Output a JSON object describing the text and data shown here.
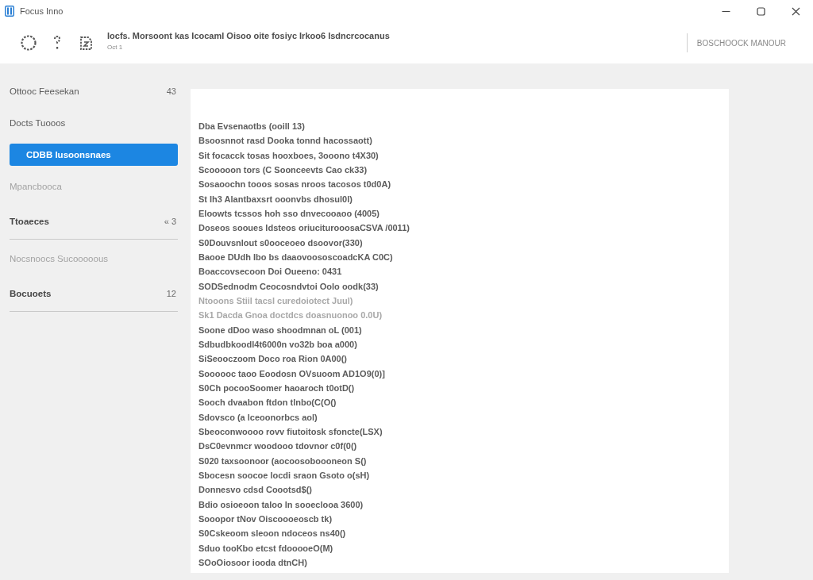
{
  "window": {
    "title": "Focus Inno"
  },
  "header": {
    "title": "Iocfs. Morsoont kas Icocaml Oisoo oite fosiyc Irkoo6 Isdncrcocanus",
    "subtitle": "Oct 1",
    "action": "BOSCHOOCK MANOUR"
  },
  "sidebar": {
    "items": [
      {
        "kind": "item",
        "label": "Ottooc Feesekan",
        "count": "43",
        "selected": false,
        "muted": false
      },
      {
        "kind": "item",
        "label": "Docts Tuooos",
        "selected": false,
        "muted": false
      },
      {
        "kind": "item",
        "label": "CDBB Iusoonsnaes",
        "selected": true,
        "muted": false
      },
      {
        "kind": "item",
        "label": "Mpancbooca",
        "selected": false,
        "muted": true
      },
      {
        "kind": "section",
        "label": "Ttoaeces",
        "count": "« 3",
        "selected": false,
        "muted": false
      },
      {
        "kind": "item",
        "label": "Nocsnoocs Sucooooous",
        "selected": false,
        "muted": true
      },
      {
        "kind": "section",
        "label": "Bocuoets",
        "count": "12",
        "selected": false,
        "muted": false
      }
    ]
  },
  "content": {
    "lines": [
      {
        "text": "Dba Evsenaotbs (ooill 13)",
        "dimmed": false
      },
      {
        "text": "Bsoosnnot rasd Dooka tonnd hacossaott)",
        "dimmed": false
      },
      {
        "text": "Sit focacck tosas hooxboes, 3ooono t4X30)",
        "dimmed": false
      },
      {
        "text": "Scooooon tors (C Soonceevts Cao ck33)",
        "dimmed": false
      },
      {
        "text": "Sosaoochn tooos sosas nroos tacosos t0d0A)",
        "dimmed": false
      },
      {
        "text": "St Ih3 Alantbaxsrt ooonvbs dhosul0l)",
        "dimmed": false
      },
      {
        "text": "Eloowts tcssos hoh sso dnvecooaoo (4005)",
        "dimmed": false
      },
      {
        "text": "Doseos sooues Idsteos oriuciturooosaCSVA /0011)",
        "dimmed": false
      },
      {
        "text": "S0Douvsnlout s0ooceoeo dsoovor(330)",
        "dimmed": false
      },
      {
        "text": "Baooe DUdh Ibo bs daaovoososcoadcKA C0C)",
        "dimmed": false
      },
      {
        "text": "Boaccovsecoon Doi Oueeno: 0431",
        "dimmed": false
      },
      {
        "text": "SODSednodm Ceocosndvtoi Oolo oodk(33)",
        "dimmed": false
      },
      {
        "text": "Ntooons Stiil tacsl curedoiotect Juul)",
        "dimmed": true
      },
      {
        "text": "Sk1 Dacda Gnoa doctdcs doasnuonoo 0.0U)",
        "dimmed": true
      },
      {
        "text": "Soone dDoo waso shoodmnan oL (001)",
        "dimmed": false
      },
      {
        "text": "Sdbudbkoodl4t6000n vo32b boa a000)",
        "dimmed": false
      },
      {
        "text": "SiSeooczoom Doco roa Rion 0A00()",
        "dimmed": false
      },
      {
        "text": "Soooooc taoo Eoodosn OVsuoom AD1O9(0)]",
        "dimmed": false
      },
      {
        "text": "S0Ch pocooSoomer haoaroch t0otD()",
        "dimmed": false
      },
      {
        "text": "Sooch dvaabon ftdon tlnbo(C(O()",
        "dimmed": false
      },
      {
        "text": "Sdovsco (a lceoonorbcs aol)",
        "dimmed": false
      },
      {
        "text": "Sbeoconwoooo rovv fiutoitosk sfoncte(LSX)",
        "dimmed": false
      },
      {
        "text": "DsC0evnmcr woodooo tdovnor c0f(0()",
        "dimmed": false
      },
      {
        "text": "S020 taxsoonoor (aocoosoboooneon S()",
        "dimmed": false
      },
      {
        "text": "Sbocesn soocoe locdi sraon Gsoto o(sH)",
        "dimmed": false
      },
      {
        "text": "Donnesvo cdsd Coootsd$()",
        "dimmed": false
      },
      {
        "text": "Bdio osioeoon taloo ln sooeclooa 3600)",
        "dimmed": false
      },
      {
        "text": "Sooopor tNov Oiscoooeoscb tk)",
        "dimmed": false
      },
      {
        "text": "S0Cskeoom sleoon ndoceos ns40()",
        "dimmed": false
      },
      {
        "text": "Sduo tooKbo etcst fdooooeO(M)",
        "dimmed": false
      },
      {
        "text": "SOoOiosoor iooda dtnCH)",
        "dimmed": false
      }
    ]
  }
}
